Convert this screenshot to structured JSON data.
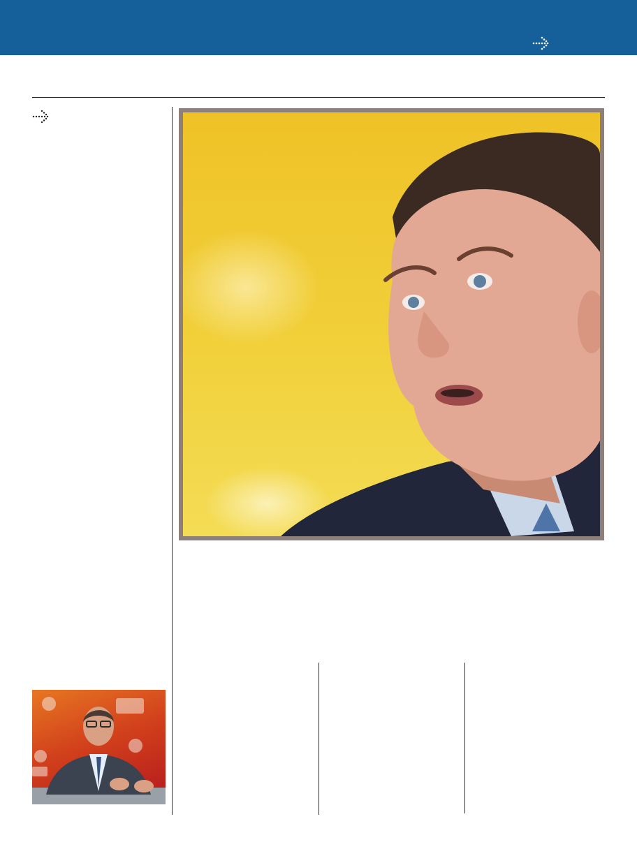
{
  "header": {
    "nav_icon": "dotted-arrow-right-icon",
    "bar_color": "#155f9b"
  },
  "sidebar": {
    "nav_icon": "dotted-arrow-right-icon"
  },
  "main_photo": {
    "subject": "man-speaking-portrait",
    "background_color": "#f0c52c",
    "border_color": "#8e7f7a"
  },
  "thumbnail_photo": {
    "subject": "man-seated-at-press-conference",
    "background_color": "#c93a1c"
  }
}
